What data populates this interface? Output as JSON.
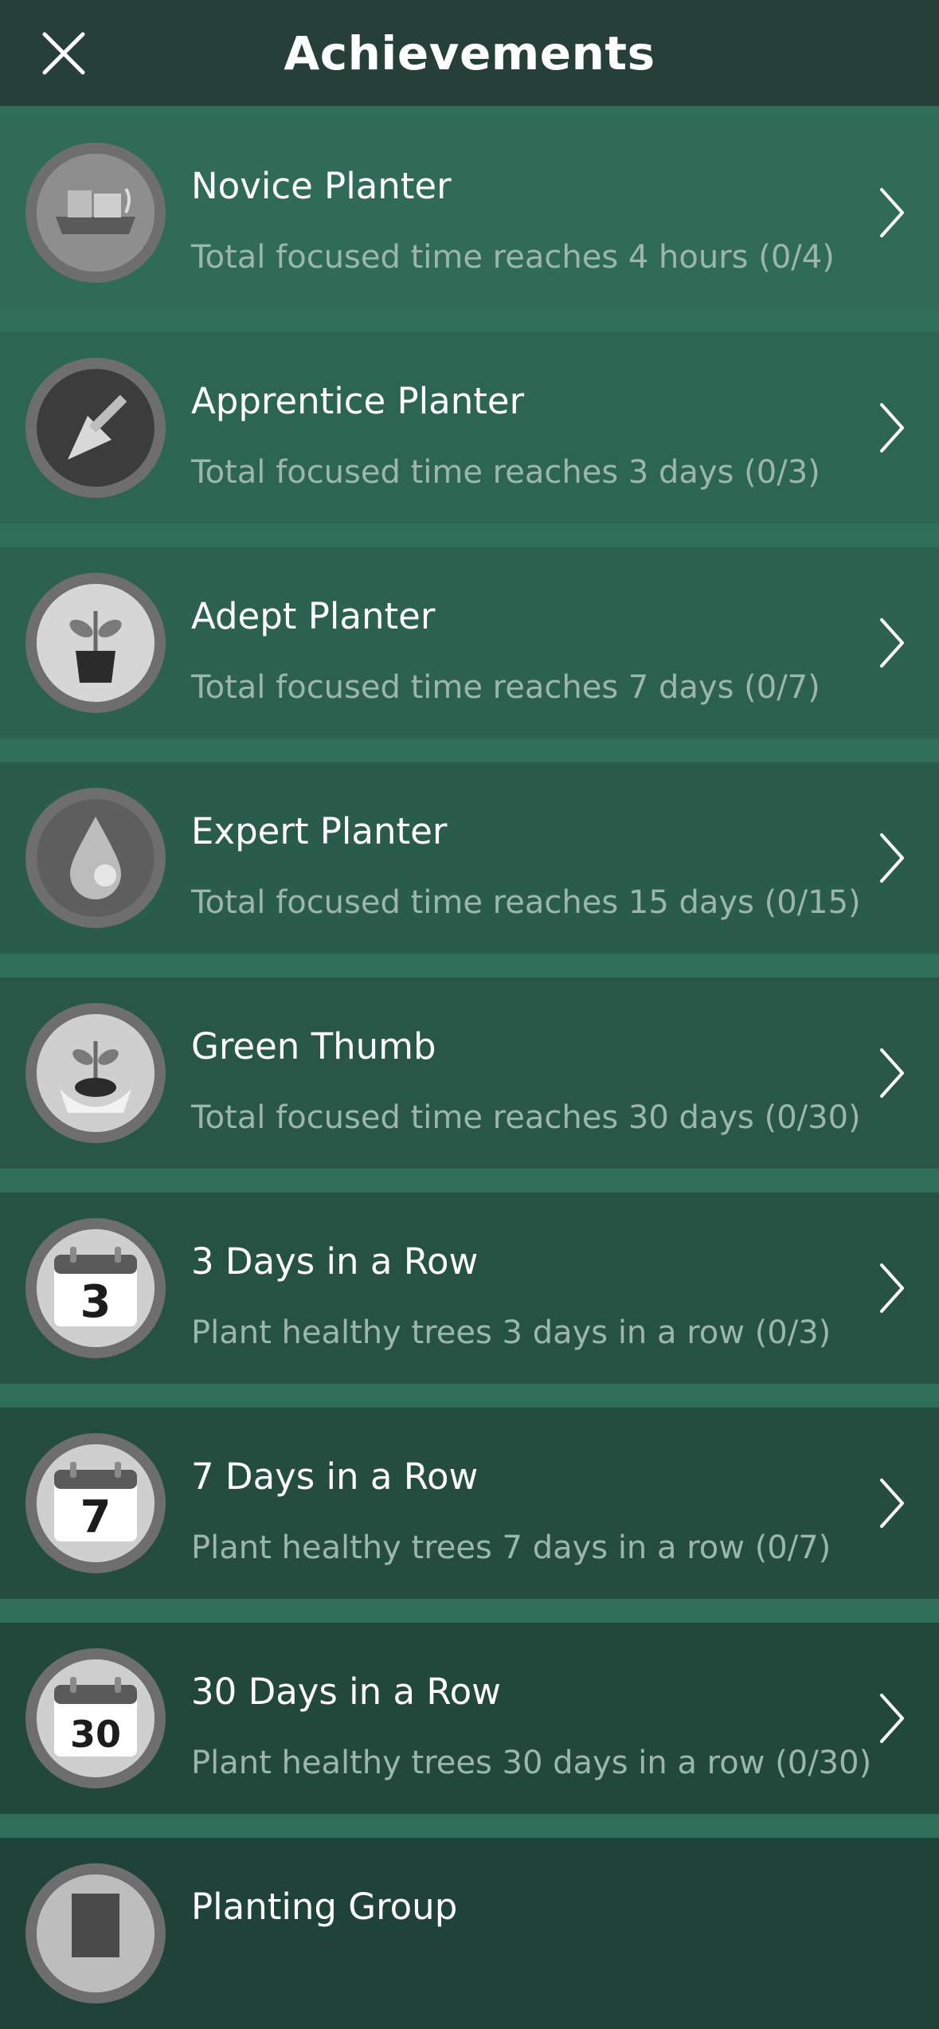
{
  "header": {
    "title": "Achievements",
    "close_icon": "close-icon"
  },
  "achievements": [
    {
      "title": "Novice Planter",
      "desc": "Total focused time reaches 4 hours (0/4)",
      "icon": "garden-bed-icon"
    },
    {
      "title": "Apprentice Planter",
      "desc": "Total focused time reaches 3 days (0/3)",
      "icon": "trowel-icon"
    },
    {
      "title": "Adept Planter",
      "desc": "Total focused time reaches 7 days (0/7)",
      "icon": "potted-plant-icon"
    },
    {
      "title": "Expert Planter",
      "desc": "Total focused time reaches 15 days (0/15)",
      "icon": "water-drop-icon"
    },
    {
      "title": "Green Thumb",
      "desc": "Total focused time reaches 30 days (0/30)",
      "icon": "hands-sprout-icon"
    },
    {
      "title": "3 Days in a Row",
      "desc": "Plant healthy trees 3 days in a row (0/3)",
      "icon": "calendar-icon",
      "number": "3"
    },
    {
      "title": "7 Days in a Row",
      "desc": "Plant healthy trees 7 days in a row  (0/7)",
      "icon": "calendar-icon",
      "number": "7"
    },
    {
      "title": "30 Days in a Row",
      "desc": "Plant healthy trees 30 days in a row  (0/30)",
      "icon": "calendar-icon",
      "number": "30"
    },
    {
      "title": "Planting Group",
      "desc": "",
      "icon": "group-icon"
    }
  ],
  "colors": {
    "header_bg": "#263f38",
    "separator": "#2f6e58",
    "row_bgs": [
      "#306b57",
      "#2d6553",
      "#2c614f",
      "#2a5c4b",
      "#285747",
      "#265243",
      "#244d40",
      "#22483c",
      "#204339"
    ]
  }
}
